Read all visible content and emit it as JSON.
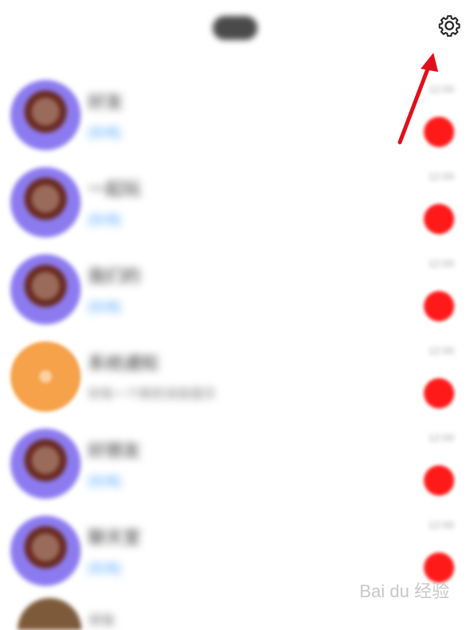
{
  "header": {
    "title": "消息",
    "settings_icon": "gear-icon"
  },
  "annotation": {
    "color": "#e0101b"
  },
  "contacts": [
    {
      "name": "好友",
      "status": "[在线]",
      "time": "12:00",
      "avatar": "boy"
    },
    {
      "name": "一起玩",
      "status": "[在线]",
      "time": "12:00",
      "avatar": "boy"
    },
    {
      "name": "我们的",
      "status": "[在线]",
      "time": "12:00",
      "avatar": "boy"
    },
    {
      "name": "系统通知",
      "status": "你有一个新的消息提示",
      "time": "12:00",
      "avatar": "orange"
    },
    {
      "name": "好朋友",
      "status": "[在线]",
      "time": "12:00",
      "avatar": "boy"
    },
    {
      "name": "聊天室",
      "status": "[在线]",
      "time": "12:00",
      "avatar": "boy"
    }
  ],
  "partial_contact": {
    "name": "好友"
  },
  "watermark": "Bai du 经验",
  "colors": {
    "badge": "#ff1a1a",
    "status_online": "#4da3ff",
    "avatar_ring": "#8c7bf0"
  }
}
